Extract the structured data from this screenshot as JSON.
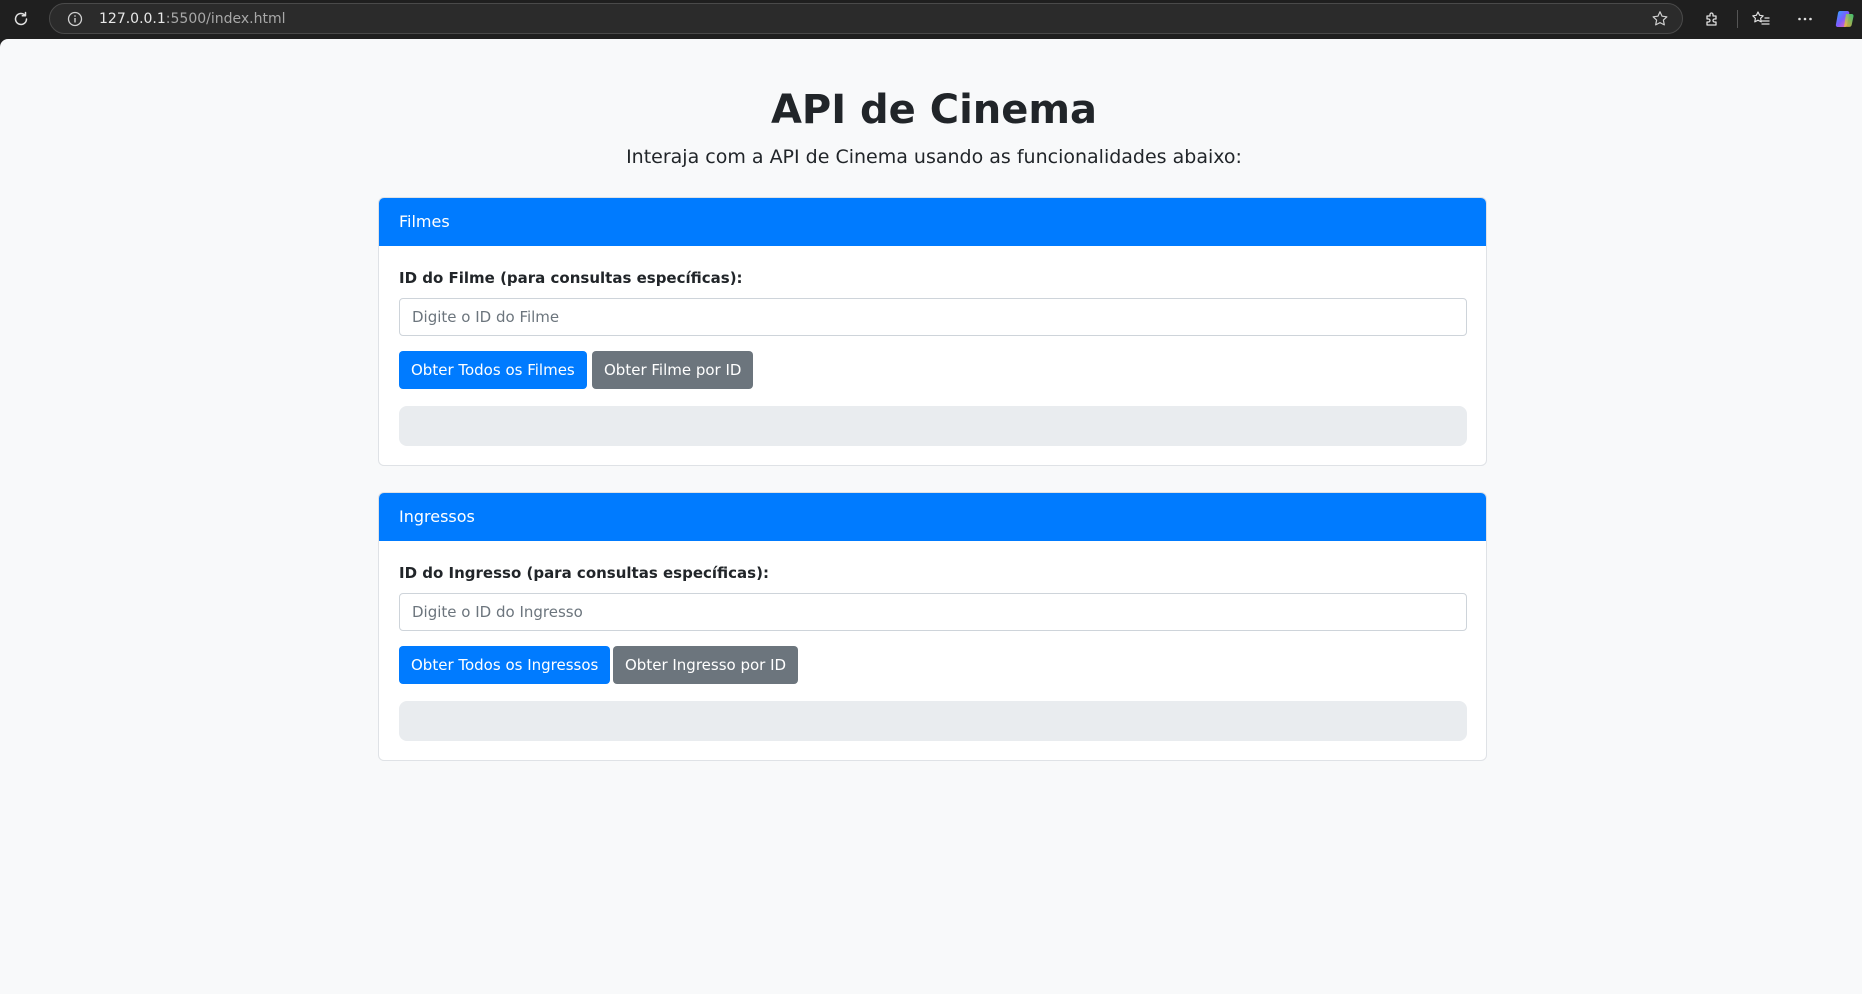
{
  "browser": {
    "url_host": "127.0.0.1",
    "url_rest": ":5500/index.html"
  },
  "page": {
    "title": "API de Cinema",
    "lead": "Interaja com a API de Cinema usando as funcionalidades abaixo:"
  },
  "filmes": {
    "header": "Filmes",
    "label": "ID do Filme (para consultas específicas):",
    "placeholder": "Digite o ID do Filme",
    "input_value": "",
    "btn_all": "Obter Todos os Filmes",
    "btn_by_id": "Obter Filme por ID",
    "result": ""
  },
  "ingressos": {
    "header": "Ingressos",
    "label": "ID do Ingresso (para consultas específicas):",
    "placeholder": "Digite o ID do Ingresso",
    "input_value": "",
    "btn_all": "Obter Todos os Ingressos",
    "btn_by_id": "Obter Ingresso por ID",
    "result": ""
  },
  "colors": {
    "primary": "#007bff",
    "secondary": "#6c757d",
    "page_bg": "#f8f9fa",
    "result_bg": "#e9ecef"
  },
  "icons": {
    "reload": "reload-icon",
    "info": "info-icon",
    "favorite": "star-icon",
    "extensions": "extensions-icon",
    "favorites_list": "favorites-list-icon",
    "menu": "more-icon",
    "copilot": "copilot-icon"
  }
}
